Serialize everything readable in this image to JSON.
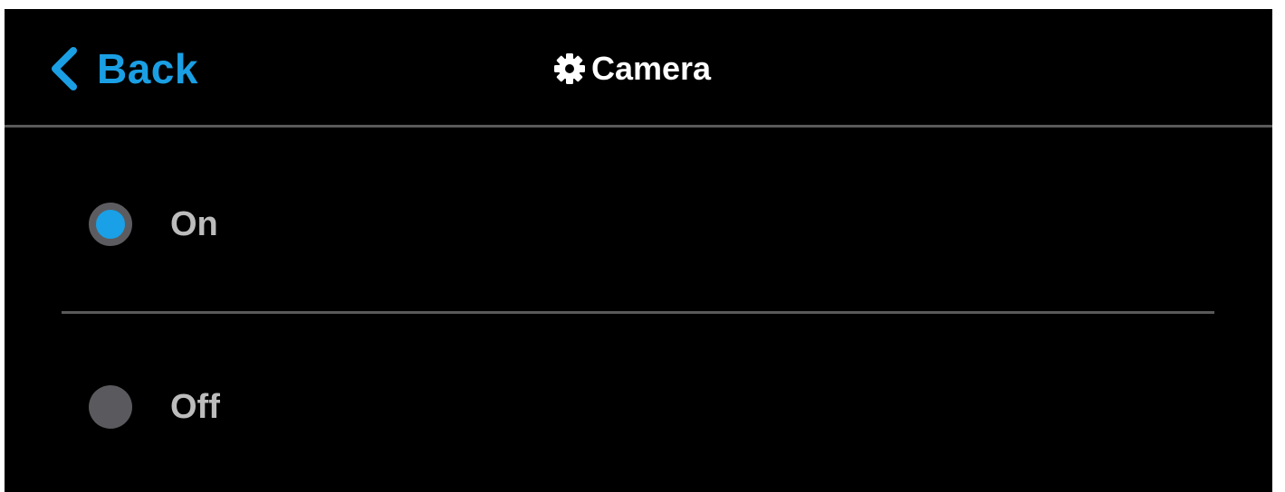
{
  "header": {
    "back_label": "Back",
    "back_icon": "chevron-left-icon",
    "title": "Camera",
    "title_icon": "gear-icon"
  },
  "options": [
    {
      "label": "On",
      "selected": true
    },
    {
      "label": "Off",
      "selected": false
    }
  ],
  "colors": {
    "background": "#000000",
    "accent": "#1a9fe4",
    "divider": "#5a5a5a",
    "radio_inactive": "#5a5a5e",
    "option_text": "#bcbcbc",
    "title_text": "#ffffff"
  }
}
